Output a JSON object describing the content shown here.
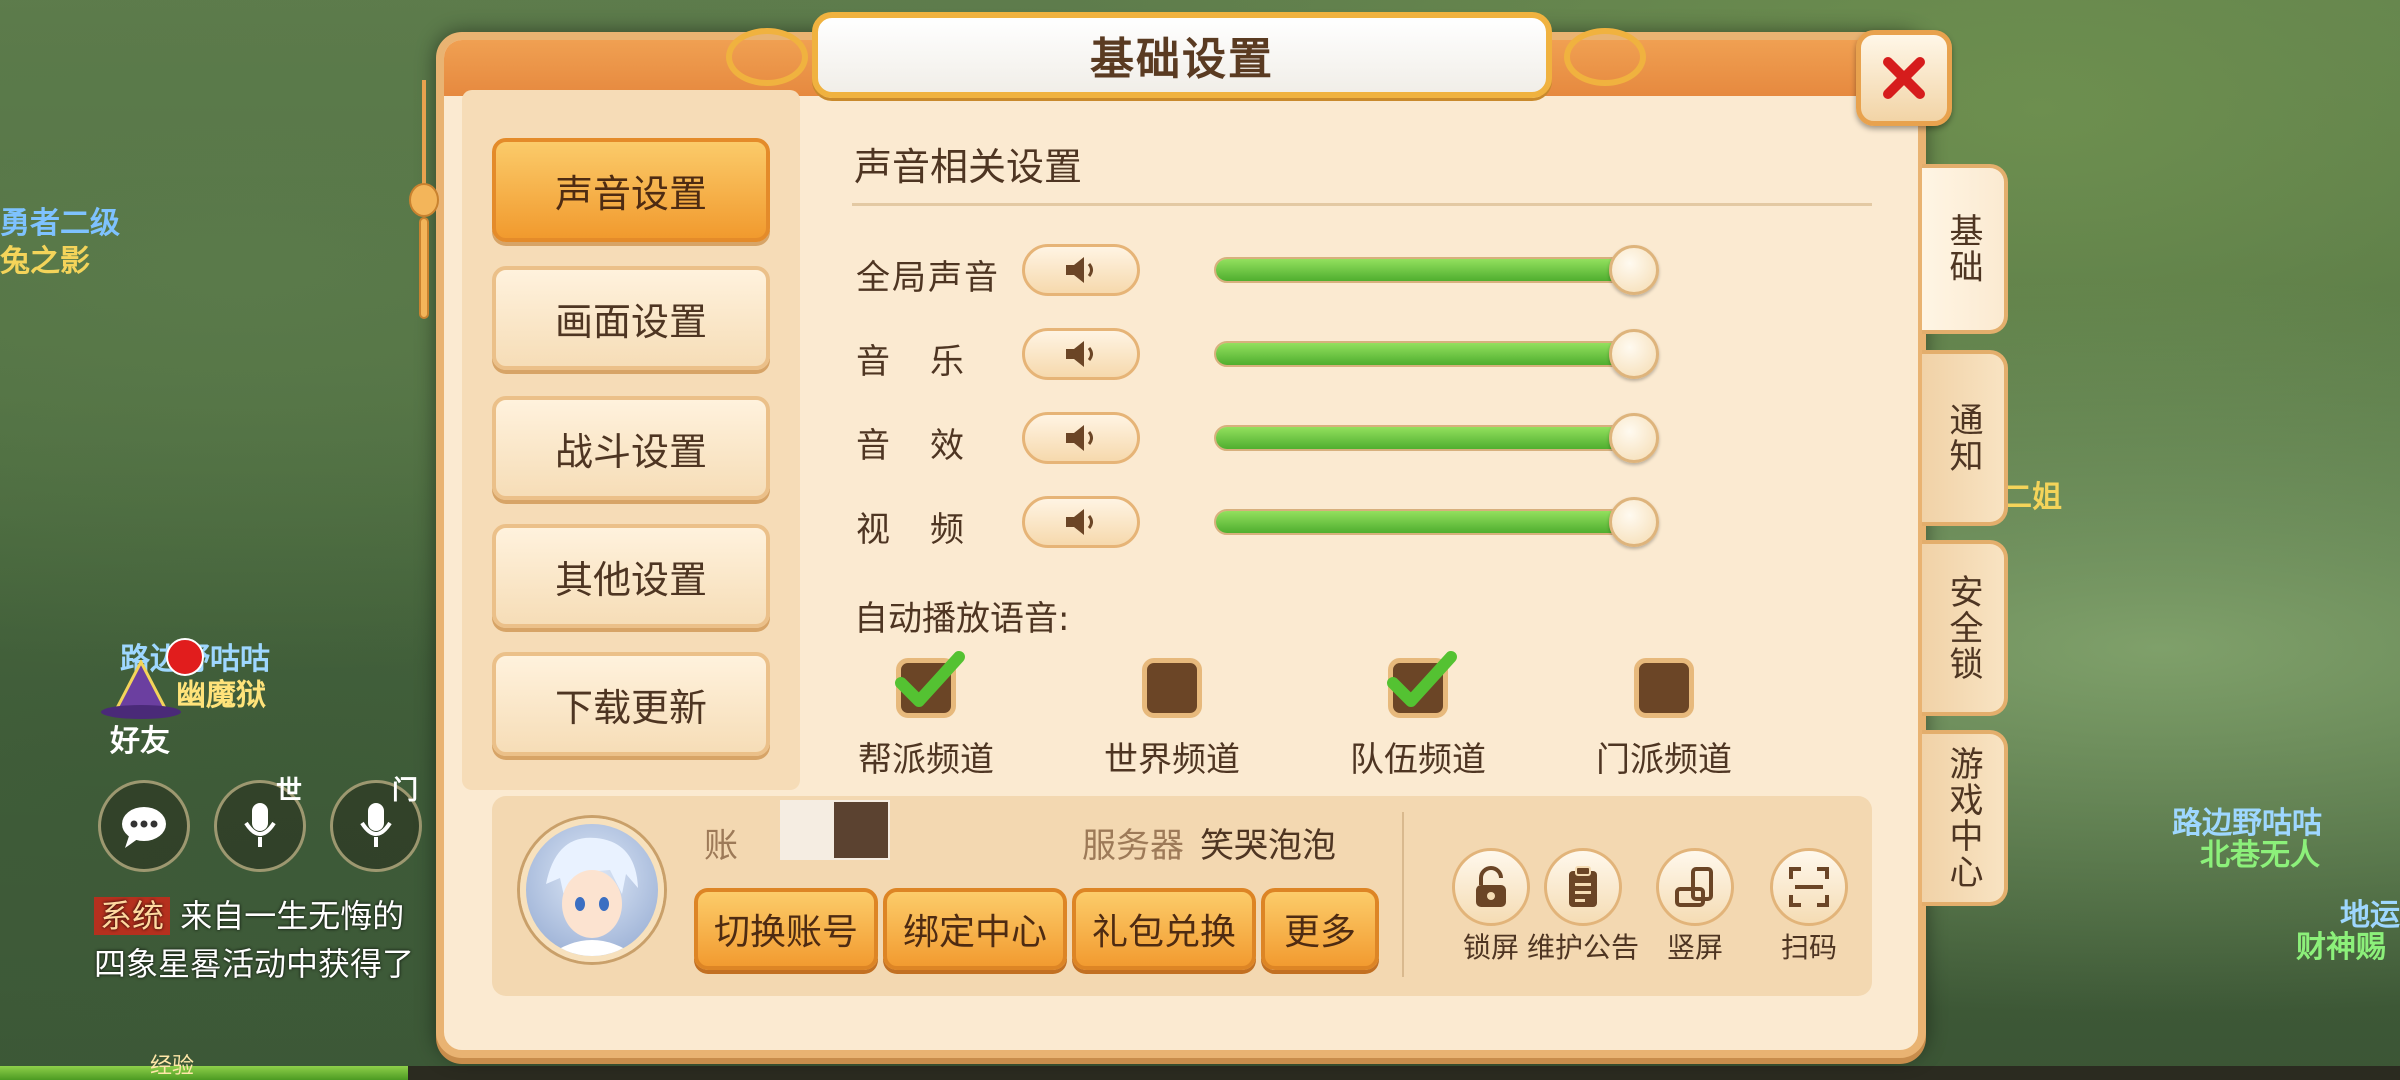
{
  "background": {
    "name_tags": [
      {
        "text": "勇者二级",
        "color": "#7ec2ff"
      },
      {
        "text": "兔之影",
        "color": "#f4d45a"
      },
      {
        "text": "路边野咕咕",
        "color": "#9ed7ff"
      },
      {
        "text": "幽魔狱",
        "color": "#ffe37a"
      },
      {
        "text": "好友",
        "color": "#ffffff"
      },
      {
        "text": "世",
        "color": "#ffffff"
      },
      {
        "text": "门",
        "color": "#ffffff"
      },
      {
        "text": "二姐",
        "color": "#f4d45a"
      },
      {
        "text": "路边野咕咕",
        "color": "#9ed7ff"
      },
      {
        "text": "北巷无人",
        "color": "#8cf07a"
      },
      {
        "text": "财神赐",
        "color": "#8cf07a"
      },
      {
        "text": "地运",
        "color": "#9ed7ff"
      }
    ],
    "chat": {
      "tag": "系统",
      "line1": "来自一生无悔的",
      "line2": "四象星晷活动中获得了"
    },
    "exp_label": "经验",
    "exp_fraction": 0.17
  },
  "dialog": {
    "title": "基础设置",
    "menu": [
      {
        "label": "声音设置",
        "active": true
      },
      {
        "label": "画面设置",
        "active": false
      },
      {
        "label": "战斗设置",
        "active": false
      },
      {
        "label": "其他设置",
        "active": false
      },
      {
        "label": "下载更新",
        "active": false
      }
    ],
    "section_title": "声音相关设置",
    "sound_rows": [
      {
        "label": "全局声音",
        "level": 1.0
      },
      {
        "label": "音乐",
        "level": 1.0
      },
      {
        "label": "音效",
        "level": 1.0
      },
      {
        "label": "视频",
        "level": 1.0
      }
    ],
    "autoplay_label": "自动播放语音:",
    "channels": [
      {
        "label": "帮派频道",
        "checked": true
      },
      {
        "label": "世界频道",
        "checked": false
      },
      {
        "label": "队伍频道",
        "checked": true
      },
      {
        "label": "门派频道",
        "checked": false
      }
    ],
    "account": {
      "account_label": "账",
      "server_label": "服务器",
      "server_name": "笑哭泡泡",
      "buttons": [
        "切换账号",
        "绑定中心",
        "礼包兑换",
        "更多"
      ],
      "tools": [
        "锁屏",
        "维护公告",
        "竖屏",
        "扫码"
      ]
    },
    "side_tabs": [
      {
        "label": "基础",
        "active": true
      },
      {
        "label": "通知",
        "active": false
      },
      {
        "label": "安全锁",
        "active": false
      },
      {
        "label": "游戏中心",
        "active": false
      }
    ]
  },
  "colors": {
    "accent_orange": "#f19a2e",
    "slider_green": "#4fae2f",
    "panel_bg": "#fbead1"
  }
}
